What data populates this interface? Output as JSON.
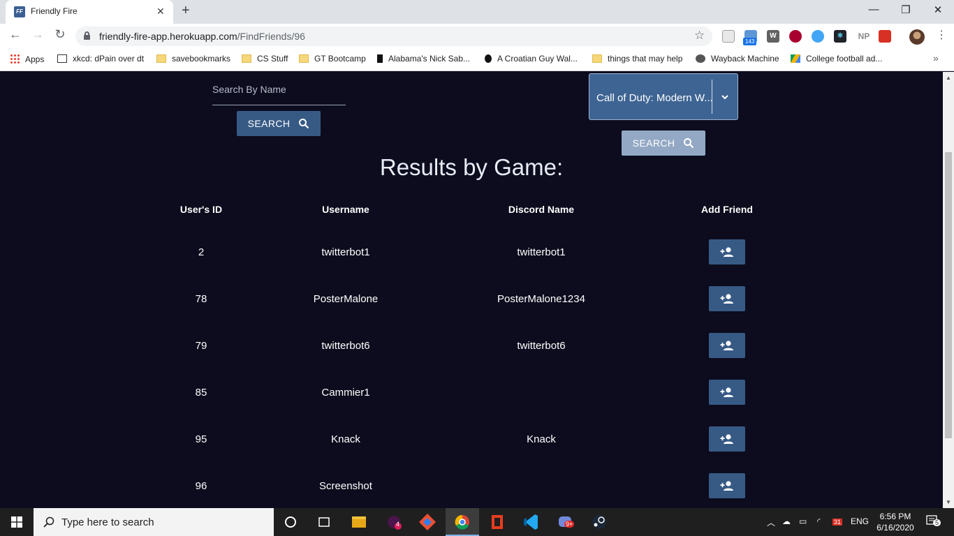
{
  "browser": {
    "tab_favicon": "FF",
    "tab_title": "Friendly Fire",
    "url_host": "friendly-fire-app.herokuapp.com",
    "url_path": "/FindFriends/96",
    "extension_badge": "143",
    "extension_np": "NP",
    "extension_w": "W"
  },
  "bookmarks": [
    {
      "label": "Apps",
      "icon": "apps-grid-icon"
    },
    {
      "label": "xkcd: dPain over dt",
      "icon": "xkcd-icon"
    },
    {
      "label": "savebookmarks",
      "icon": "folder-icon"
    },
    {
      "label": "CS Stuff",
      "icon": "folder-icon"
    },
    {
      "label": "GT Bootcamp",
      "icon": "folder-icon"
    },
    {
      "label": "Alabama's Nick Sab...",
      "icon": "cursor-icon"
    },
    {
      "label": "A Croatian Guy Wal...",
      "icon": "head-icon"
    },
    {
      "label": "things that may help",
      "icon": "folder-icon"
    },
    {
      "label": "Wayback Machine",
      "icon": "globe-icon"
    },
    {
      "label": "College football ad...",
      "icon": "drive-icon"
    }
  ],
  "search": {
    "name_placeholder": "Search By Name",
    "name_button": "SEARCH",
    "game_selected": "Call of Duty: Modern W...",
    "game_button": "SEARCH"
  },
  "results": {
    "title": "Results by Game:",
    "headers": [
      "User's ID",
      "Username",
      "Discord Name",
      "Add Friend"
    ],
    "rows": [
      {
        "id": "2",
        "username": "twitterbot1",
        "discord": "twitterbot1"
      },
      {
        "id": "78",
        "username": "PosterMalone",
        "discord": "PosterMalone1234"
      },
      {
        "id": "79",
        "username": "twitterbot6",
        "discord": "twitterbot6"
      },
      {
        "id": "85",
        "username": "Cammier1",
        "discord": ""
      },
      {
        "id": "95",
        "username": "Knack",
        "discord": "Knack"
      },
      {
        "id": "96",
        "username": "Screenshot",
        "discord": ""
      }
    ]
  },
  "taskbar": {
    "search_placeholder": "Type here to search",
    "slack_badge": "4",
    "discord_badge": "9+",
    "calendar_badge": "31",
    "language": "ENG",
    "time": "6:56 PM",
    "date": "6/16/2020",
    "notification_count": "5"
  },
  "colors": {
    "page_background": "#0c0c1e",
    "button_primary": "#375a85",
    "button_disabled": "#93a8c4",
    "select_background": "#3e6493"
  }
}
